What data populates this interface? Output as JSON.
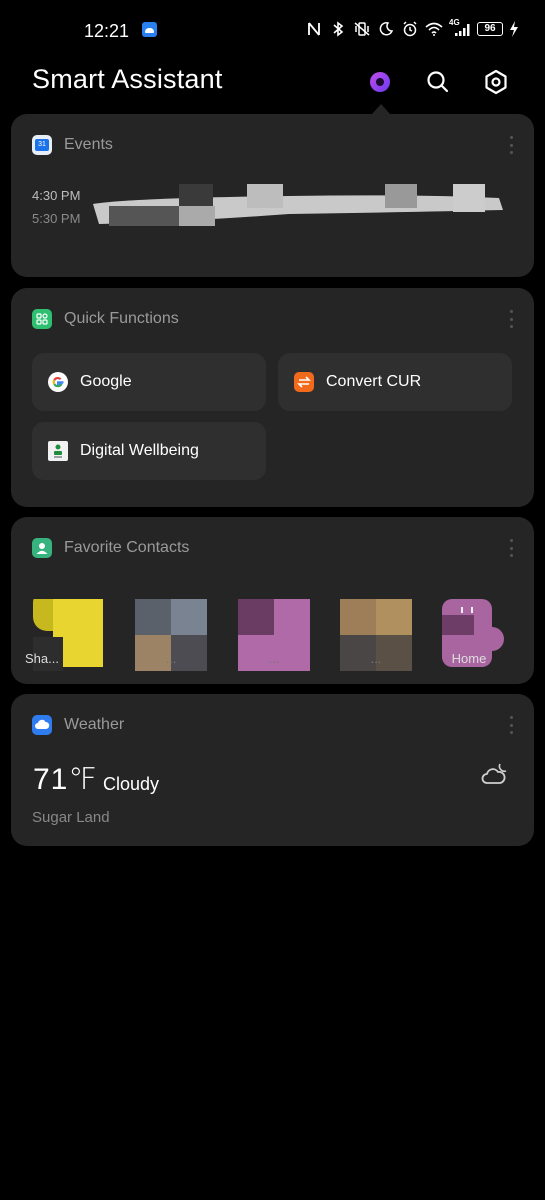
{
  "status_bar": {
    "time": "12:21",
    "battery": "96",
    "network": "4G",
    "icons": [
      "nfc-icon",
      "bluetooth-icon",
      "vibrate-icon",
      "moon-icon",
      "alarm-icon",
      "wifi-icon",
      "signal-icon",
      "battery-icon",
      "charging-icon"
    ]
  },
  "header": {
    "title": "Smart Assistant",
    "buttons": [
      "assistant-orb-icon",
      "search-icon",
      "settings-icon"
    ]
  },
  "events": {
    "title": "Events",
    "icon": "calendar-icon",
    "icon_text": "31",
    "start_time": "4:30 PM",
    "end_time": "5:30 PM"
  },
  "quick_functions": {
    "title": "Quick Functions",
    "items": [
      {
        "label": "Google",
        "icon": "google-icon"
      },
      {
        "label": "Convert CUR",
        "icon": "convert-currency-icon"
      },
      {
        "label": "Digital Wellbeing",
        "icon": "digital-wellbeing-icon"
      }
    ]
  },
  "favorite_contacts": {
    "title": "Favorite Contacts",
    "contacts": [
      {
        "name": "Sha...",
        "color": "#e0d030"
      },
      {
        "name": "...",
        "color": "#6c7583"
      },
      {
        "name": "...",
        "color": "#b06aa8"
      },
      {
        "name": "...",
        "color": "#b0905f"
      },
      {
        "name": "Home",
        "color": "#a865a0"
      }
    ]
  },
  "weather": {
    "title": "Weather",
    "temperature": "71℉",
    "condition": "Cloudy",
    "location": "Sugar Land",
    "icon": "partly-cloudy-night-icon"
  }
}
